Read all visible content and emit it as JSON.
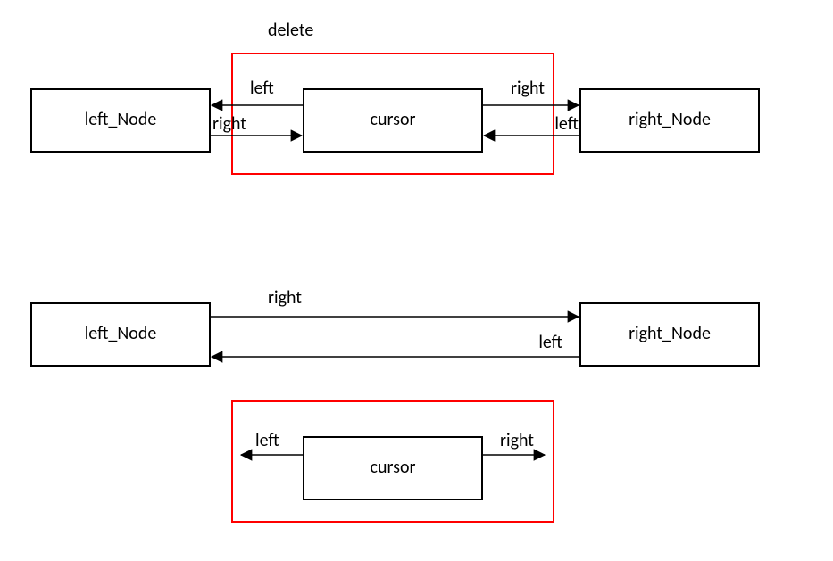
{
  "labels": {
    "delete": "delete",
    "left_node": "left_Node",
    "right_node": "right_Node",
    "cursor": "cursor",
    "left": "left",
    "right": "right"
  },
  "colors": {
    "highlight": "#ff0000",
    "line": "#000000"
  },
  "diagram": {
    "description": "Deletion of the cursor node from a doubly-linked list: after deletion left_Node.right points to right_Node and right_Node.left points to left_Node; cursor keeps dangling left/right pointers.",
    "before": {
      "nodes": [
        "left_Node",
        "cursor",
        "right_Node"
      ],
      "pointers": [
        {
          "from": "left_Node",
          "name": "right",
          "to": "cursor"
        },
        {
          "from": "cursor",
          "name": "left",
          "to": "left_Node"
        },
        {
          "from": "cursor",
          "name": "right",
          "to": "right_Node"
        },
        {
          "from": "right_Node",
          "name": "left",
          "to": "cursor"
        }
      ],
      "marked_for_delete": "cursor"
    },
    "after": {
      "nodes": [
        "left_Node",
        "right_Node"
      ],
      "pointers": [
        {
          "from": "left_Node",
          "name": "right",
          "to": "right_Node"
        },
        {
          "from": "right_Node",
          "name": "left",
          "to": "left_Node"
        }
      ],
      "detached": {
        "node": "cursor",
        "pointers": [
          {
            "from": "cursor",
            "name": "left",
            "to": null
          },
          {
            "from": "cursor",
            "name": "right",
            "to": null
          }
        ]
      }
    }
  }
}
